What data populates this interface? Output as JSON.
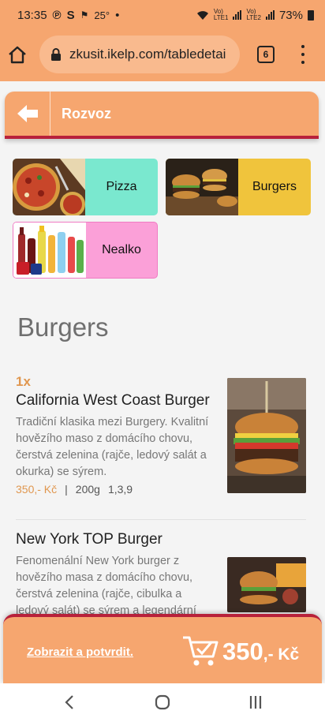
{
  "status_bar": {
    "time": "13:35",
    "notif_p": "℗",
    "notif_s": "S",
    "notif_flag": "⚑",
    "temp": "25°",
    "dot": "•",
    "sim1_top": "Vo)",
    "sim1_bot": "LTE1",
    "sim2_top": "Vo)",
    "sim2_bot": "LTE2",
    "battery": "73%"
  },
  "browser": {
    "url": "zkusit.ikelp.com/tabledetai",
    "tab_count": "6"
  },
  "header": {
    "title": "Rozvoz"
  },
  "categories": [
    {
      "label": "Pizza",
      "color": "#7ae8cf"
    },
    {
      "label": "Burgers",
      "color": "#f0c43c"
    },
    {
      "label": "Nealko",
      "color": "#fba0d8"
    }
  ],
  "section_title": "Burgers",
  "items": [
    {
      "qty": "1x",
      "name": "California West Coast Burger",
      "description": "Tradiční klasika mezi Burgery. Kvalitní hovězího maso z domácího chovu, čerstvá zelenina (rajče, ledový salát a okurka) se sýrem.",
      "price": "350,- Kč",
      "separator": "|",
      "weight": "200g",
      "allergens": "1,3,9"
    },
    {
      "name": "New York TOP Burger",
      "description": "Fenomenální New York burger z hovězího masa z domácího chovu, čerstvá zelenina (rajče, cibulka a ledový salát) se sýrem a legendární"
    }
  ],
  "cart": {
    "confirm_label": "Zobrazit a potvrdit.",
    "total_amount": "350",
    "total_suffix": ",- Kč"
  },
  "colors": {
    "brand_orange": "#f6a66f",
    "accent_red": "#b8213b",
    "price_orange": "#e0974f"
  }
}
